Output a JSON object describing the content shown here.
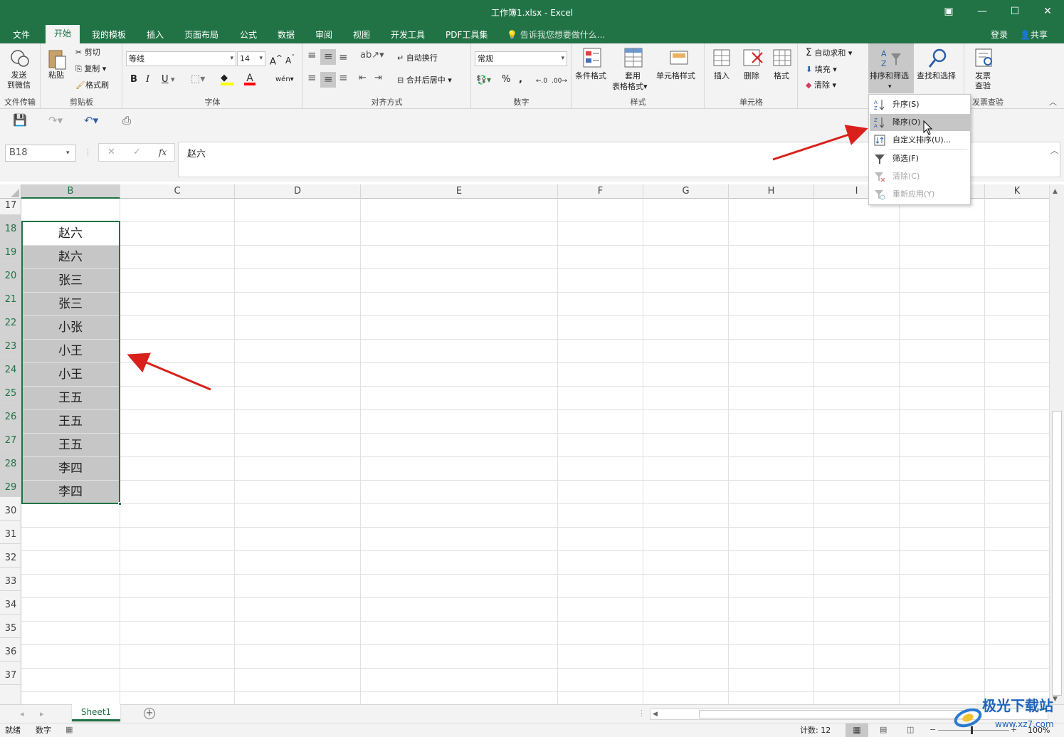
{
  "window": {
    "title": "工作簿1.xlsx - Excel"
  },
  "menu": {
    "tabs": [
      "文件",
      "开始",
      "我的模板",
      "插入",
      "页面布局",
      "公式",
      "数据",
      "审阅",
      "视图",
      "开发工具",
      "PDF工具集"
    ],
    "active_tab": "开始",
    "tell_me": "告诉我您想要做什么...",
    "login": "登录",
    "share": "共享"
  },
  "ribbon": {
    "send": {
      "label1": "发送",
      "label2": "到微信",
      "group": "文件传输"
    },
    "clipboard": {
      "paste": "粘贴",
      "cut": "剪切",
      "copy": "复制",
      "format_painter": "格式刷",
      "group": "剪贴板"
    },
    "font": {
      "name": "等线",
      "size": "14",
      "group": "字体",
      "bold": "B",
      "italic": "I",
      "underline": "U"
    },
    "align": {
      "wrap": "自动换行",
      "merge": "合并后居中",
      "group": "对齐方式"
    },
    "number": {
      "format": "常规",
      "group": "数字"
    },
    "styles": {
      "conditional": "条件格式",
      "table1": "套用",
      "table2": "表格格式",
      "cell_style": "单元格样式",
      "group": "样式"
    },
    "cells": {
      "insert": "插入",
      "delete": "删除",
      "format": "格式",
      "group": "单元格"
    },
    "editing": {
      "autosum": "自动求和",
      "fill": "填充",
      "clear": "清除",
      "sort_filter": "排序和筛选",
      "find_select": "查找和选择"
    },
    "invoice": {
      "label1": "发票",
      "label2": "查验",
      "group": "发票查验"
    }
  },
  "formula_bar": {
    "name_box": "B18",
    "value": "赵六"
  },
  "columns": [
    "B",
    "C",
    "D",
    "E",
    "F",
    "G",
    "H",
    "I",
    "K"
  ],
  "rows": [
    "17",
    "18",
    "19",
    "20",
    "21",
    "22",
    "23",
    "24",
    "25",
    "26",
    "27",
    "28",
    "29",
    "30",
    "31",
    "32",
    "33",
    "34",
    "35",
    "36",
    "37"
  ],
  "cells_b": [
    "",
    "赵六",
    "赵六",
    "张三",
    "张三",
    "小张",
    "小王",
    "小王",
    "王五",
    "王五",
    "王五",
    "李四",
    "李四"
  ],
  "sort_menu": [
    {
      "label": "升序(S)",
      "icon": "sort-ascending-icon",
      "state": "normal"
    },
    {
      "label": "降序(O)",
      "icon": "sort-descending-icon",
      "state": "hover"
    },
    {
      "label": "自定义排序(U)...",
      "icon": "custom-sort-icon",
      "state": "normal"
    },
    {
      "label": "筛选(F)",
      "icon": "filter-icon",
      "state": "normal"
    },
    {
      "label": "清除(C)",
      "icon": "clear-filter-icon",
      "state": "disabled"
    },
    {
      "label": "重新应用(Y)",
      "icon": "reapply-icon",
      "state": "disabled"
    }
  ],
  "sheet": {
    "tab": "Sheet1"
  },
  "status": {
    "ready": "就绪",
    "num": "数字",
    "count": "计数: 12",
    "zoom": "100%"
  },
  "watermark": "极光下载站",
  "watermark_url": "www.xz7.com",
  "colors": {
    "excel_green": "#217346",
    "arrow_red": "#d9201a"
  }
}
